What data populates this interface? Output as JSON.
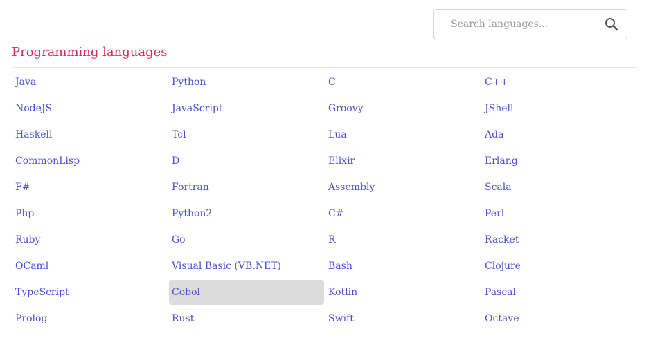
{
  "search": {
    "placeholder": "Search languages...",
    "value": "",
    "icon": "search-icon"
  },
  "title": "Programming languages",
  "colors": {
    "title": "#dc2a58",
    "link": "#4a4fd6",
    "highlight_bg": "#dcdcdc",
    "divider": "#e6e6e6"
  },
  "highlighted_item": "Cobol",
  "languages": [
    "Java",
    "Python",
    "C",
    "C++",
    "NodeJS",
    "JavaScript",
    "Groovy",
    "JShell",
    "Haskell",
    "Tcl",
    "Lua",
    "Ada",
    "CommonLisp",
    "D",
    "Elixir",
    "Erlang",
    "F#",
    "Fortran",
    "Assembly",
    "Scala",
    "Php",
    "Python2",
    "C#",
    "Perl",
    "Ruby",
    "Go",
    "R",
    "Racket",
    "OCaml",
    "Visual Basic (VB.NET)",
    "Bash",
    "Clojure",
    "TypeScript",
    "Cobol",
    "Kotlin",
    "Pascal",
    "Prolog",
    "Rust",
    "Swift",
    "Octave"
  ]
}
